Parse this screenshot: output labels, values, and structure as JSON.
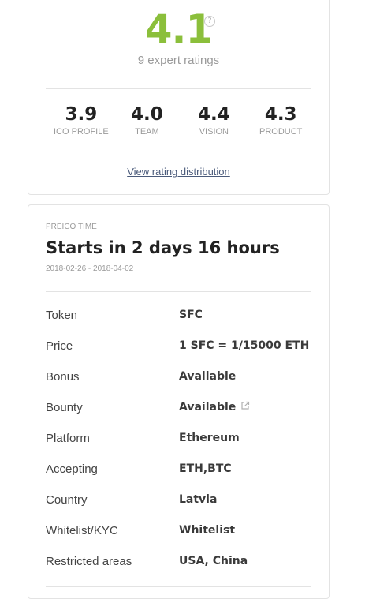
{
  "rating": {
    "score": "4.1",
    "help_glyph": "?",
    "expert_ratings": "9 expert ratings",
    "subscores": [
      {
        "value": "3.9",
        "label": "ICO PROFILE"
      },
      {
        "value": "4.0",
        "label": "TEAM"
      },
      {
        "value": "4.4",
        "label": "VISION"
      },
      {
        "value": "4.3",
        "label": "PRODUCT"
      }
    ],
    "distribution_link": "View rating distribution"
  },
  "preico": {
    "label": "PREICO TIME",
    "starts": "Starts in 2 days 16 hours",
    "dates": "2018-02-26 - 2018-04-02",
    "details": [
      {
        "key": "Token",
        "value": "SFC"
      },
      {
        "key": "Price",
        "value": "1 SFC = 1/15000 ETH"
      },
      {
        "key": "Bonus",
        "value": "Available"
      },
      {
        "key": "Bounty",
        "value": "Available",
        "icon": "external-link-icon"
      },
      {
        "key": "Platform",
        "value": "Ethereum"
      },
      {
        "key": "Accepting",
        "value": "ETH,BTC"
      },
      {
        "key": "Country",
        "value": "Latvia"
      },
      {
        "key": "Whitelist/KYC",
        "value": "Whitelist"
      },
      {
        "key": "Restricted areas",
        "value": "USA, China"
      }
    ]
  },
  "colors": {
    "score": "#8bbf3b",
    "link": "#4a5a7a"
  }
}
